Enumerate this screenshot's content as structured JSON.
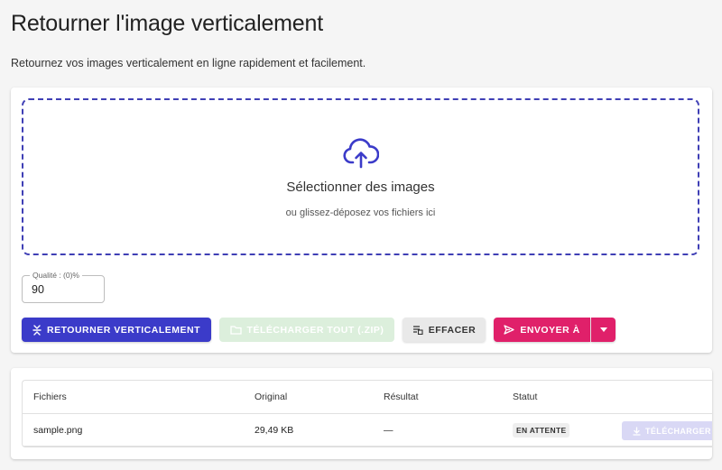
{
  "page": {
    "title": "Retourner l'image verticalement",
    "subtitle": "Retournez vos images verticalement en ligne rapidement et facilement."
  },
  "dropzone": {
    "icon": "cloud-upload-icon",
    "title": "Sélectionner des images",
    "subtitle": "ou glissez-déposez vos fichiers ici"
  },
  "quality": {
    "label": "Qualité : (0)%",
    "value": "90"
  },
  "actions": {
    "flip_label": "Retourner verticalement",
    "download_all_label": "Télécharger tout (.zip)",
    "clear_label": "Effacer",
    "send_label": "Envoyer à"
  },
  "table": {
    "headers": {
      "files": "Fichiers",
      "original": "Original",
      "result": "Résultat",
      "status": "Statut"
    },
    "rows": [
      {
        "name": "sample.png",
        "original": "29,49 KB",
        "result": "—",
        "status": "EN ATTENTE",
        "download_label": "Télécharger"
      }
    ]
  },
  "colors": {
    "primary": "#3b3bc9",
    "accent": "#e0206a",
    "success_disabled": "#dcefdc",
    "dropzone_border": "#3f3fb5"
  }
}
